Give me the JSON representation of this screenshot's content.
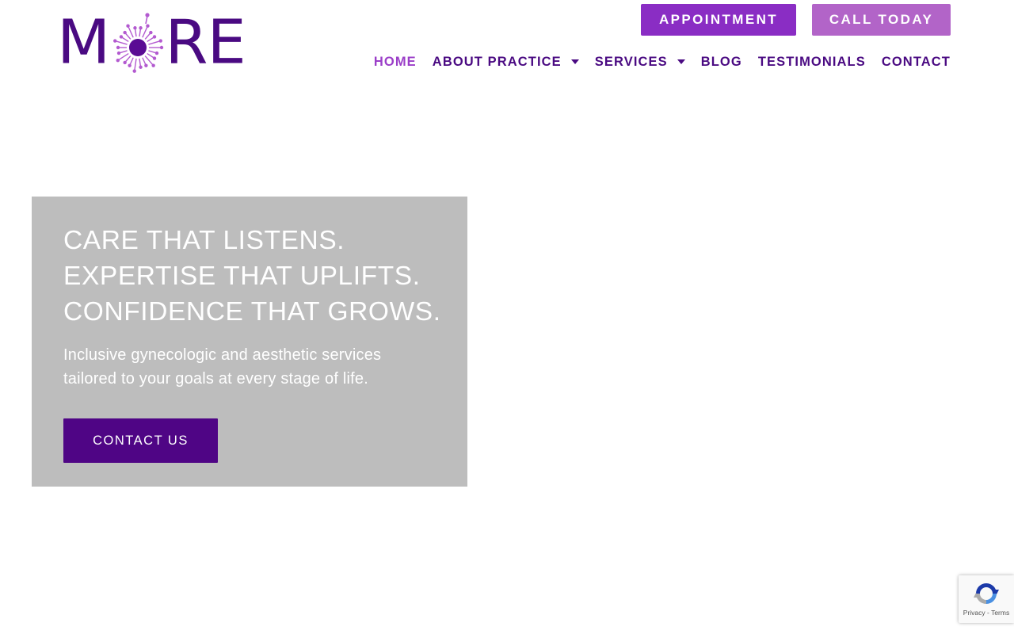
{
  "brand": {
    "logo_letters": [
      "M",
      "R",
      "E"
    ],
    "logo_alt": "MORE",
    "color_primary": "#4a0a82",
    "color_accent": "#9b3ec8"
  },
  "header": {
    "appointment_label": "APPOINTMENT",
    "call_label": "CALL TODAY",
    "nav": [
      {
        "label": "HOME",
        "active": true,
        "dropdown": false
      },
      {
        "label": "ABOUT PRACTICE",
        "active": false,
        "dropdown": true
      },
      {
        "label": "SERVICES",
        "active": false,
        "dropdown": true
      },
      {
        "label": "BLOG",
        "active": false,
        "dropdown": false
      },
      {
        "label": "TESTIMONIALS",
        "active": false,
        "dropdown": false
      },
      {
        "label": "CONTACT",
        "active": false,
        "dropdown": false
      }
    ]
  },
  "hero": {
    "title_lines": [
      "CARE THAT LISTENS.",
      "EXPERTISE THAT UPLIFTS.",
      "CONFIDENCE THAT GROWS."
    ],
    "subtitle": "Inclusive gynecologic and aesthetic services tailored to your goals at every stage of life.",
    "cta_label": "CONTACT US"
  },
  "recaptcha": {
    "links": "Privacy - Terms",
    "icon": "recaptcha-icon"
  }
}
